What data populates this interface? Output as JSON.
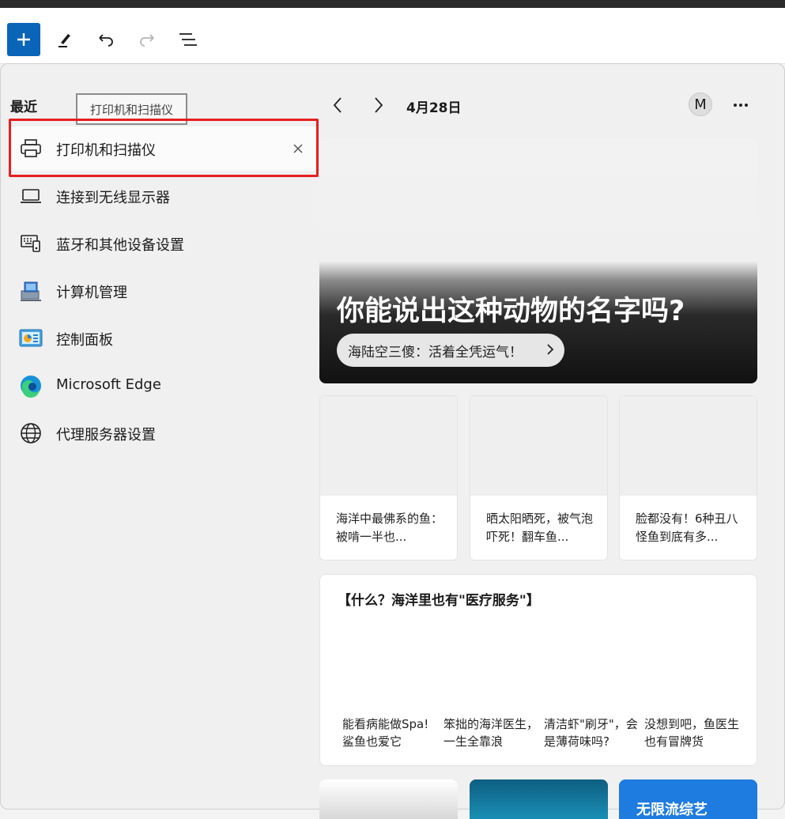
{
  "toolbar": {
    "add_label": "+",
    "icons": [
      "plus-icon",
      "pen-icon",
      "undo-icon",
      "redo-icon",
      "menu-icon"
    ]
  },
  "search": {
    "section_title": "最近",
    "tooltip": "打印机和扫描仪",
    "items": [
      {
        "label": "打印机和扫描仪",
        "icon": "printer-icon"
      },
      {
        "label": "连接到无线显示器",
        "icon": "laptop-icon"
      },
      {
        "label": "蓝牙和其他设备设置",
        "icon": "devices-icon"
      },
      {
        "label": "计算机管理",
        "icon": "computer-management-icon"
      },
      {
        "label": "控制面板",
        "icon": "control-panel-icon"
      },
      {
        "label": "Microsoft Edge",
        "icon": "edge-icon"
      },
      {
        "label": "代理服务器设置",
        "icon": "globe-icon"
      }
    ]
  },
  "news": {
    "date": "4月28日",
    "avatar_initial": "M",
    "hero_title": "你能说出这种动物的名字吗?",
    "hero_subtitle": "海陆空三傻：活着全凭运气！",
    "cards": [
      {
        "text": "海洋中最佛系的鱼：被啃一半也..."
      },
      {
        "text": "晒太阳晒死，被气泡吓死！翻车鱼..."
      },
      {
        "text": "脸都没有！6种丑八怪鱼到底有多..."
      }
    ],
    "feature_title": "【什么？海洋里也有\"医疗服务\"】",
    "feature_items": [
      "能看病能做Spa! 鲨鱼也爱它",
      "笨拙的海洋医生，一生全靠浪",
      "清洁虾\"刷牙\"，会是薄荷味吗?",
      "没想到吧，鱼医生也有冒牌货"
    ],
    "bottom_card_text": "无限流综艺"
  },
  "colors": {
    "accent": "#0a64b7",
    "highlight_border": "#e61e1e"
  }
}
